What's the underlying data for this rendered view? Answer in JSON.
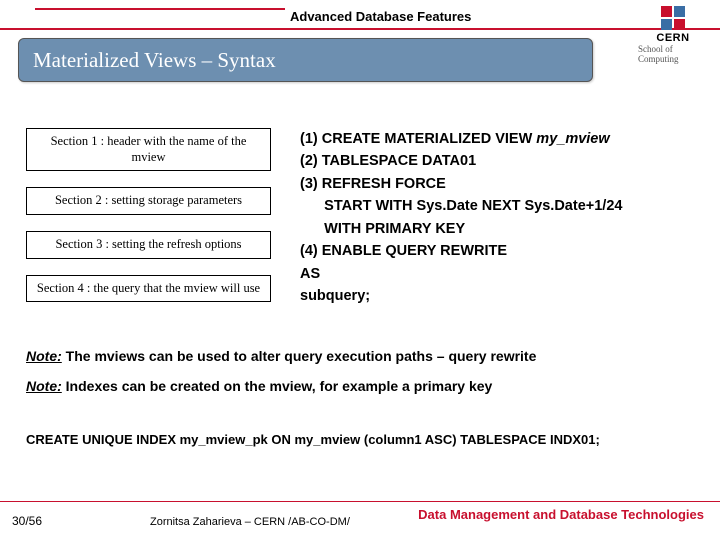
{
  "header": {
    "topic": "Advanced Database Features",
    "logo": {
      "brand": "CERN",
      "sub": "School of Computing"
    }
  },
  "title": "Materialized Views – Syntax",
  "sections": [
    "Section 1 : header with the name of the mview",
    "Section 2 : setting storage parameters",
    "Section 3 : setting the refresh options",
    "Section 4 : the query that the mview will use"
  ],
  "code": {
    "l1a": "(1) CREATE MATERIALIZED VIEW ",
    "l1b": "my_mview",
    "l2": "(2) TABLESPACE DATA01",
    "l3": "(3) REFRESH FORCE",
    "l4": "      START WITH Sys.Date NEXT Sys.Date+1/24",
    "l5": "      WITH PRIMARY KEY",
    "l6": "(4) ENABLE QUERY REWRITE",
    "l7": "AS",
    "l8": "subquery;"
  },
  "notes": {
    "label": "Note:",
    "n1": " The mviews can be used to alter query execution paths – query rewrite",
    "n2": " Indexes can be created on the mview, for example a primary key"
  },
  "create_index": "CREATE UNIQUE INDEX my_mview_pk ON my_mview (column1 ASC) TABLESPACE INDX01;",
  "footer": {
    "slide": "30/56",
    "author": "Zornitsa Zaharieva – CERN /AB-CO-DM/",
    "topic": "Data Management and Database Technologies"
  }
}
